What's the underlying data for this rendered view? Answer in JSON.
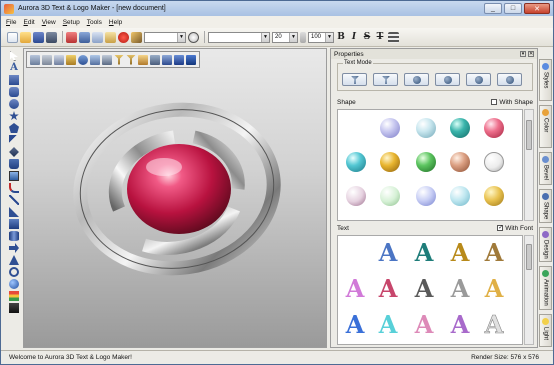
{
  "window": {
    "title": "Aurora 3D Text & Logo Maker - [new document]",
    "buttons": [
      "_",
      "□",
      "✕"
    ]
  },
  "menu": [
    {
      "key": "F",
      "rest": "ile"
    },
    {
      "key": "E",
      "rest": "dit"
    },
    {
      "key": "V",
      "rest": "iew"
    },
    {
      "key": "S",
      "rest": "etup"
    },
    {
      "key": "T",
      "rest": "ools"
    },
    {
      "key": "H",
      "rest": "elp"
    }
  ],
  "toolbar": {
    "font_size": "20",
    "zoom": "100",
    "bold": "B",
    "italic": "I",
    "strike": "S",
    "text_format": "T"
  },
  "properties": {
    "title": "Properties",
    "text_mode_label": "Text Mode",
    "shape_label": "Shape",
    "with_shape_label": "With Shape",
    "text_label": "Text",
    "with_font_label": "With Font",
    "with_font_checked": "✓",
    "text_glyph": "A"
  },
  "side_tabs": [
    "Styles",
    "Color",
    "Bevel",
    "Shape",
    "Design",
    "Animation",
    "Light"
  ],
  "status": {
    "message": "Welcome to Aurora 3D Text & Logo Maker!",
    "render_size": "Render Size: 576 x 576"
  },
  "colors": {
    "accent": "#c41d4f",
    "titlebar": "#b5cbe9"
  }
}
